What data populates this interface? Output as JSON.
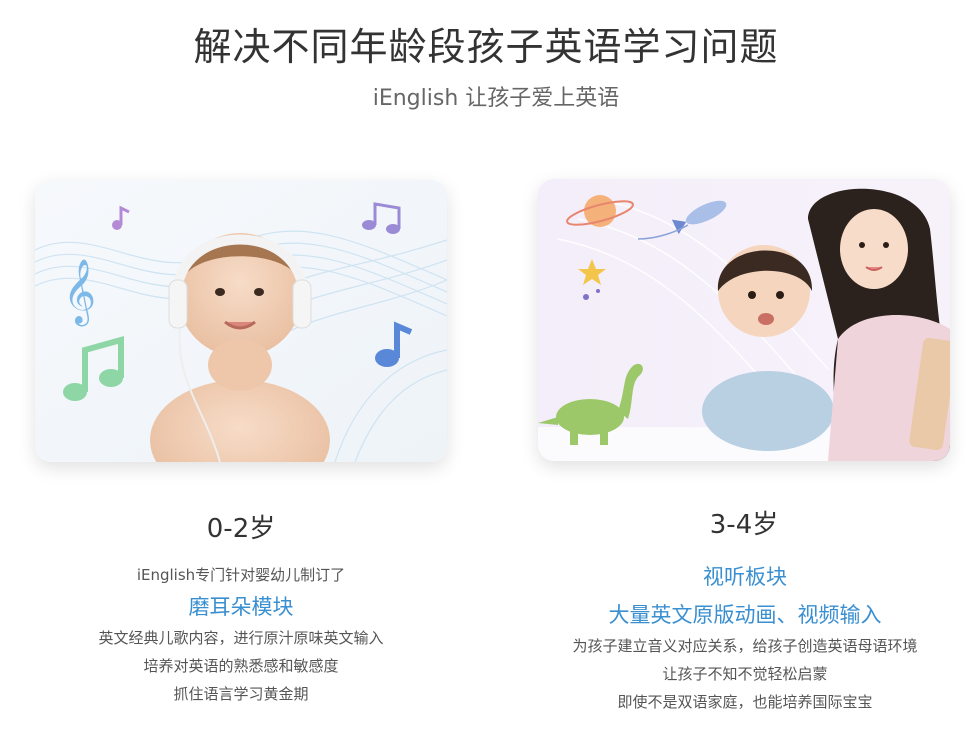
{
  "header": {
    "title": "解决不同年龄段孩子英语学习问题",
    "subtitle": "iEnglish 让孩子爱上英语"
  },
  "cards": [
    {
      "age": "0-2岁",
      "intro": "iEnglish专门针对婴幼儿制订了",
      "highlights": [
        "磨耳朵模块"
      ],
      "lines": [
        "英文经典儿歌内容，进行原汁原味英文输入",
        "培养对英语的熟悉感和敏感度",
        "抓住语言学习黄金期"
      ],
      "image_icon": "baby-with-headphones"
    },
    {
      "age": "3-4岁",
      "intro": "",
      "highlights": [
        "视听板块",
        "大量英文原版动画、视频输入"
      ],
      "lines": [
        "为孩子建立音义对应关系，给孩子创造英语母语环境",
        "让孩子不知不觉轻松启蒙",
        "即使不是双语家庭，也能培养国际宝宝"
      ],
      "image_icon": "mother-and-child-with-tablet"
    }
  ],
  "colors": {
    "accent": "#3a8fd1",
    "title": "#333333",
    "text": "#555555"
  }
}
